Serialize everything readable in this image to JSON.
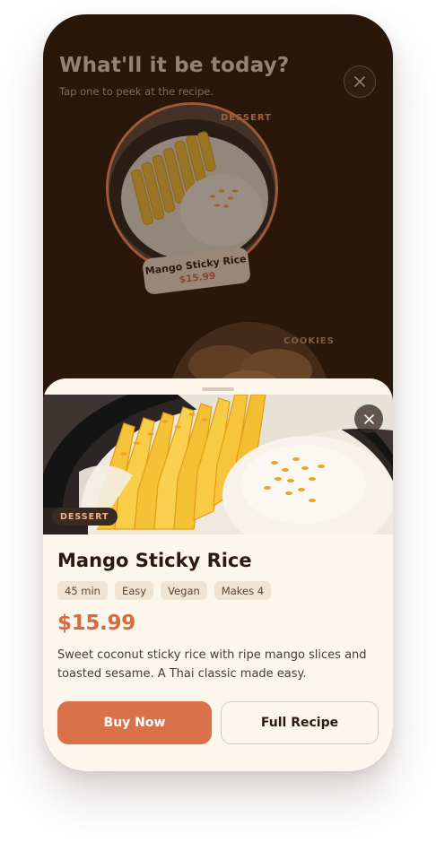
{
  "background": {
    "title": "What'll it be today?",
    "subtitle": "Tap one to peek at the recipe.",
    "featured": {
      "category": "DESSERT",
      "name": "Mango Sticky Rice",
      "price": "$15.99"
    },
    "next": {
      "category": "COOKIES"
    }
  },
  "sheet": {
    "category": "DESSERT",
    "title": "Mango Sticky Rice",
    "tags": [
      "45 min",
      "Easy",
      "Vegan",
      "Makes 4"
    ],
    "price": "$15.99",
    "description": "Sweet coconut sticky rice with ripe mango slices and toasted sesame. A Thai classic made easy.",
    "buy_label": "Buy Now",
    "recipe_label": "Full Recipe"
  },
  "icons": {
    "close": "close-icon",
    "food_photo": "mango-sticky-rice-photo"
  },
  "colors": {
    "accent": "#d9714a",
    "price": "#d76b3f",
    "background": "#2b160a",
    "sheet": "#fdf6ec"
  }
}
